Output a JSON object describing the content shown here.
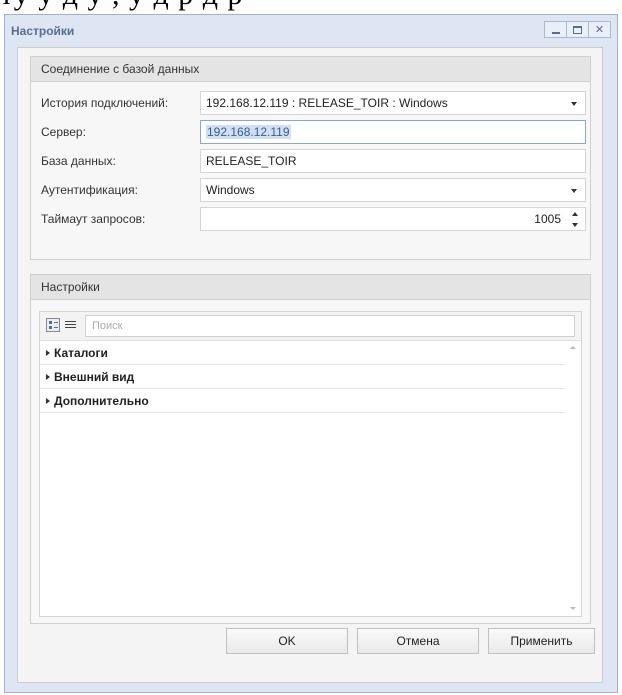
{
  "background_text": "ту у д у , у д р д р",
  "window": {
    "title": "Настройки"
  },
  "connection_group": {
    "header": "Соединение с базой данных",
    "history": {
      "label": "История подключений:",
      "value": "192.168.12.119 : RELEASE_TOIR : Windows"
    },
    "server": {
      "label": "Сервер:",
      "value": "192.168.12.119"
    },
    "database": {
      "label": "База данных:",
      "value": "RELEASE_TOIR"
    },
    "auth": {
      "label": "Аутентификация:",
      "value": "Windows"
    },
    "timeout": {
      "label": "Таймаут запросов:",
      "value": "1005"
    }
  },
  "settings_group": {
    "header": "Настройки",
    "search_placeholder": "Поиск",
    "categories": [
      "Каталоги",
      "Внешний вид",
      "Дополнительно"
    ]
  },
  "buttons": {
    "ok": "OK",
    "cancel": "Отмена",
    "apply": "Применить"
  }
}
